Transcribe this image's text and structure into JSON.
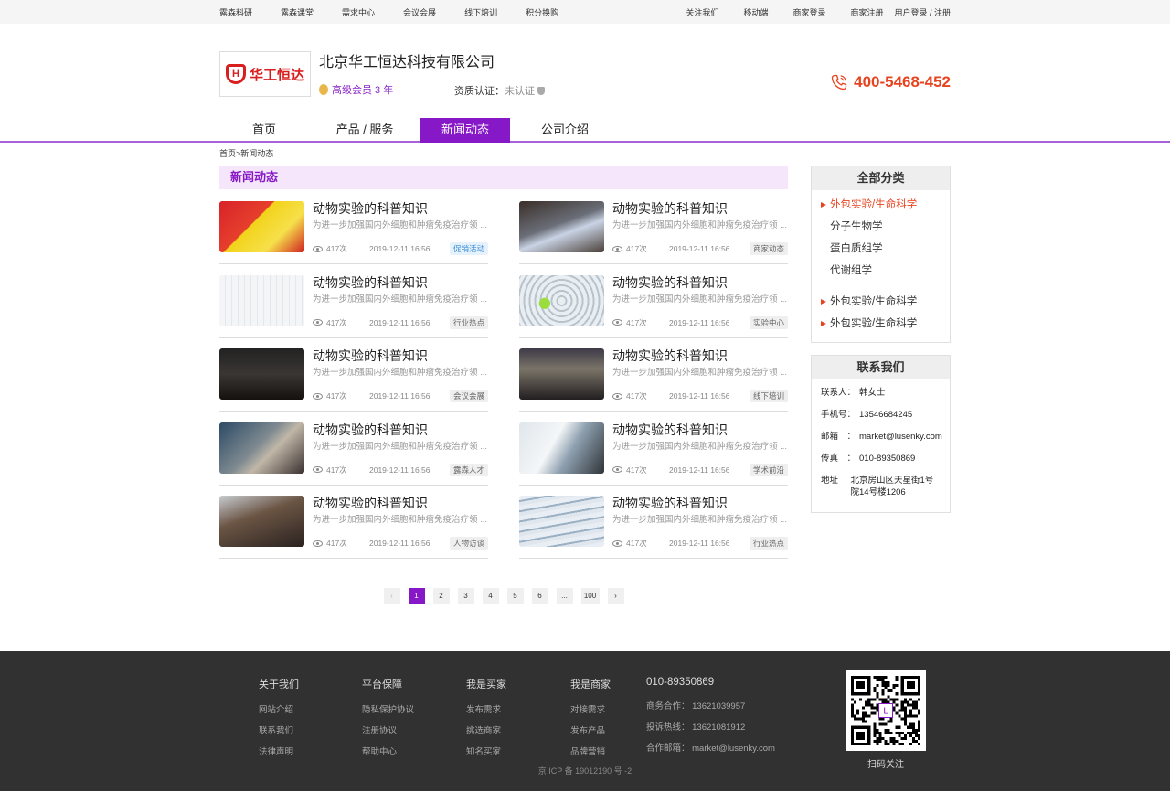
{
  "topbar": {
    "left": [
      "露森科研",
      "露森课堂",
      "需求中心",
      "会议会展",
      "线下培训",
      "积分换购"
    ],
    "right": [
      "关注我们",
      "移动端",
      "商家登录",
      "商家注册",
      "用户登录 / 注册"
    ]
  },
  "header": {
    "logo_text": "华工恒达",
    "company": "北京华工恒达科技有限公司",
    "member": "高级会员 3 年",
    "qual_label": "资质认证：",
    "qual_value": "未认证",
    "hotline": "400-5468-452"
  },
  "nav": [
    "首页",
    "产品 / 服务",
    "新闻动态",
    "公司介绍"
  ],
  "crumb": "首页>新闻动态",
  "section_title": "新闻动态",
  "articles": [
    {
      "title": "动物实验的科普知识",
      "desc": "为进一步加强国内外细胞和肿瘤免疫治疗领 ...",
      "views": "417次",
      "date": "2019-12-11  16:56",
      "tag": "促销活动"
    },
    {
      "title": "动物实验的科普知识",
      "desc": "为进一步加强国内外细胞和肿瘤免疫治疗领 ...",
      "views": "417次",
      "date": "2019-12-11  16:56",
      "tag": "商家动态"
    },
    {
      "title": "动物实验的科普知识",
      "desc": "为进一步加强国内外细胞和肿瘤免疫治疗领 ...",
      "views": "417次",
      "date": "2019-12-11  16:56",
      "tag": "行业热点"
    },
    {
      "title": "动物实验的科普知识",
      "desc": "为进一步加强国内外细胞和肿瘤免疫治疗领 ...",
      "views": "417次",
      "date": "2019-12-11  16:56",
      "tag": "实验中心"
    },
    {
      "title": "动物实验的科普知识",
      "desc": "为进一步加强国内外细胞和肿瘤免疫治疗领 ...",
      "views": "417次",
      "date": "2019-12-11  16:56",
      "tag": "会议会展"
    },
    {
      "title": "动物实验的科普知识",
      "desc": "为进一步加强国内外细胞和肿瘤免疫治疗领 ...",
      "views": "417次",
      "date": "2019-12-11  16:56",
      "tag": "线下培训"
    },
    {
      "title": "动物实验的科普知识",
      "desc": "为进一步加强国内外细胞和肿瘤免疫治疗领 ...",
      "views": "417次",
      "date": "2019-12-11  16:56",
      "tag": "露森人才"
    },
    {
      "title": "动物实验的科普知识",
      "desc": "为进一步加强国内外细胞和肿瘤免疫治疗领 ...",
      "views": "417次",
      "date": "2019-12-11  16:56",
      "tag": "学术前沿"
    },
    {
      "title": "动物实验的科普知识",
      "desc": "为进一步加强国内外细胞和肿瘤免疫治疗领 ...",
      "views": "417次",
      "date": "2019-12-11  16:56",
      "tag": "人物访谈"
    },
    {
      "title": "动物实验的科普知识",
      "desc": "为进一步加强国内外细胞和肿瘤免疫治疗领 ...",
      "views": "417次",
      "date": "2019-12-11  16:56",
      "tag": "行业热点"
    }
  ],
  "pager": [
    "‹",
    "1",
    "2",
    "3",
    "4",
    "5",
    "6",
    "...",
    "100",
    "›"
  ],
  "sidebar": {
    "cat_title": "全部分类",
    "cats": [
      "外包实验/生命科学",
      "分子生物学",
      "蛋白质组学",
      "代谢组学",
      "外包实验/生命科学",
      "外包实验/生命科学"
    ],
    "contact_title": "联系我们",
    "contact": [
      {
        "k": "联系人：",
        "v": "韩女士"
      },
      {
        "k": "手机号：",
        "v": "13546684245"
      },
      {
        "k": "邮箱　：",
        "v": "market@lusenky.com"
      },
      {
        "k": "传真　：",
        "v": "010-89350869"
      },
      {
        "k": "地址　",
        "v": "北京房山区天星街1号院14号楼1206"
      }
    ]
  },
  "footer": {
    "cols": [
      {
        "h": "关于我们",
        "items": [
          "网站介绍",
          "联系我们",
          "法律声明"
        ]
      },
      {
        "h": "平台保障",
        "items": [
          "隐私保护协议",
          "注册协议",
          "帮助中心"
        ]
      },
      {
        "h": "我是买家",
        "items": [
          "发布需求",
          "挑选商家",
          "知名买家"
        ]
      },
      {
        "h": "我是商家",
        "items": [
          "对接需求",
          "发布产品",
          "品牌营销"
        ]
      }
    ],
    "tel": "010-89350869",
    "tel_items": [
      "商务合作：  13621039957",
      "投诉热线：  13621081912",
      "合作邮箱：  market@lusenky.com"
    ],
    "qr_caption": "扫码关注",
    "icp": "京 ICP 备 19012190 号 -2"
  }
}
